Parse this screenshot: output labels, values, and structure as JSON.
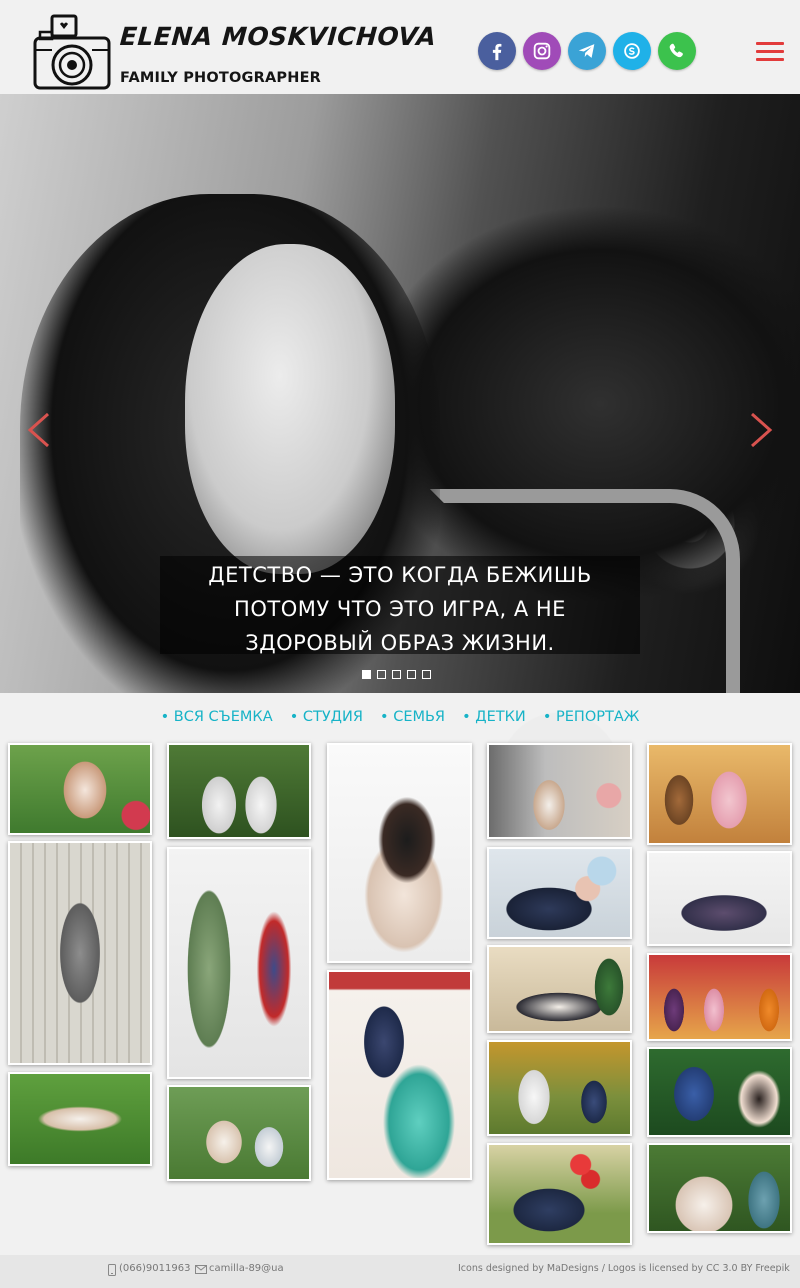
{
  "brand": {
    "name": "ELENA MOSKVICHOVA",
    "tagline": "FAMILY PHOTOGRAPHER"
  },
  "social": [
    {
      "name": "facebook",
      "icon": "facebook-icon",
      "color": "#3b5998"
    },
    {
      "name": "instagram",
      "icon": "instagram-icon",
      "color": "#9b3fb5"
    },
    {
      "name": "telegram",
      "icon": "telegram-icon",
      "color": "#2ca5e0"
    },
    {
      "name": "skype",
      "icon": "skype-icon",
      "color": "#00aff0"
    },
    {
      "name": "viber",
      "icon": "viber-icon",
      "color": "#33c44c"
    }
  ],
  "hero": {
    "caption": "ДЕТСТВО — ЭТО КОГДА БЕЖИШЬ ПОТОМУ ЧТО ЭТО ИГРА, А НЕ ЗДОРОВЫЙ ОБРАЗ ЖИЗНИ.",
    "slide_count": 5,
    "active_slide": 1
  },
  "categories": [
    "• ВСЯ СЪЕМКА",
    "• СТУДИЯ",
    "• СЕМЬЯ",
    "• ДЕТКИ",
    "• РЕПОРТАЖ"
  ],
  "colors": {
    "accent": "#17b3c7",
    "menu": "#e23b3b",
    "arrow": "#d9534f"
  },
  "footer": {
    "phone": "(066)9011963",
    "email": "camilla-89@ua",
    "credits": "Icons designed by MaDesigns / Logos is licensed by CC 3.0 BY Freepik"
  }
}
